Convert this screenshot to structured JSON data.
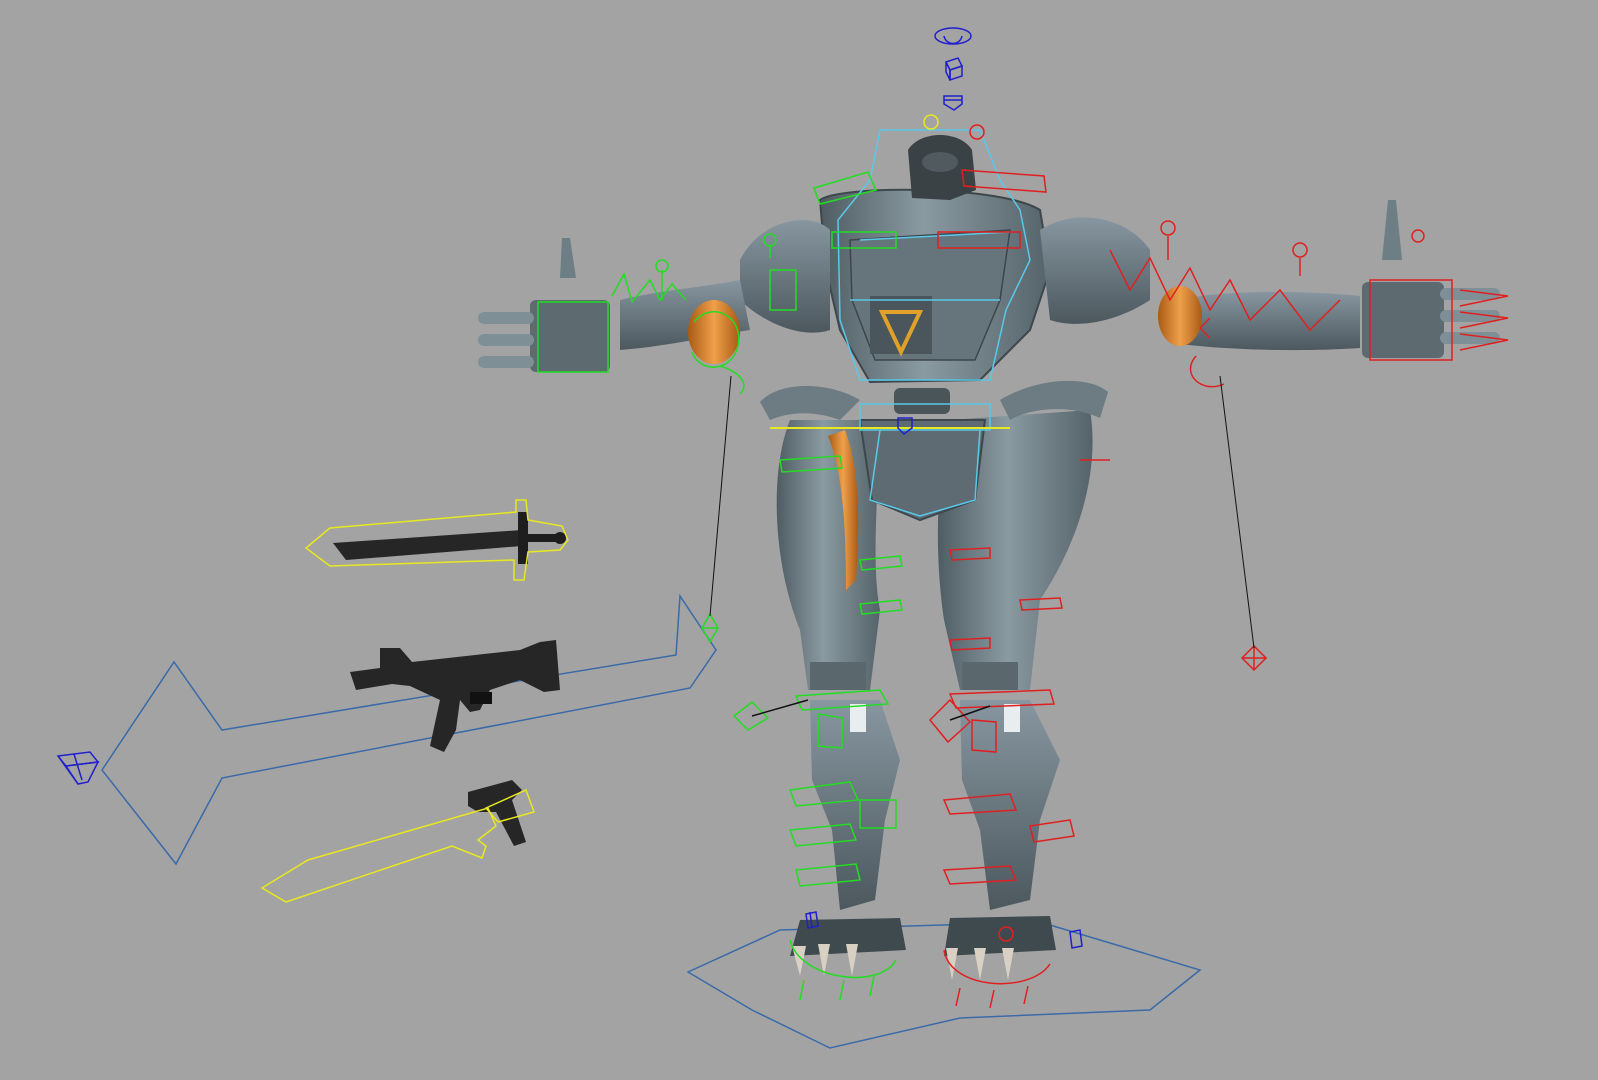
{
  "viewport": {
    "background": "#a3a3a3",
    "colors": {
      "left_controls": "#22dd22",
      "right_controls": "#e02020",
      "center_controls": "#5ac8e8",
      "weapon_controls": "#e8e820",
      "world_controls": "#3a6aa8",
      "locators": "#2020cc",
      "body_metal": "#6e7f86",
      "body_dark": "#3a3f42",
      "joint_orange": "#d9822b",
      "weapon_black": "#262626"
    }
  },
  "icons": {
    "eye_controller": "eye-locator-icon",
    "cube_locator": "cube-locator-icon",
    "camera_locator": "camera-locator-icon",
    "pole_vector_left": "diamond-locator-icon",
    "pole_vector_right": "diamond-locator-icon"
  },
  "scene_objects": [
    "robot-mech-model",
    "sword-weapon",
    "rifle-weapon",
    "pistol-weapon",
    "master-ground-control",
    "weapon-arrow-control"
  ]
}
